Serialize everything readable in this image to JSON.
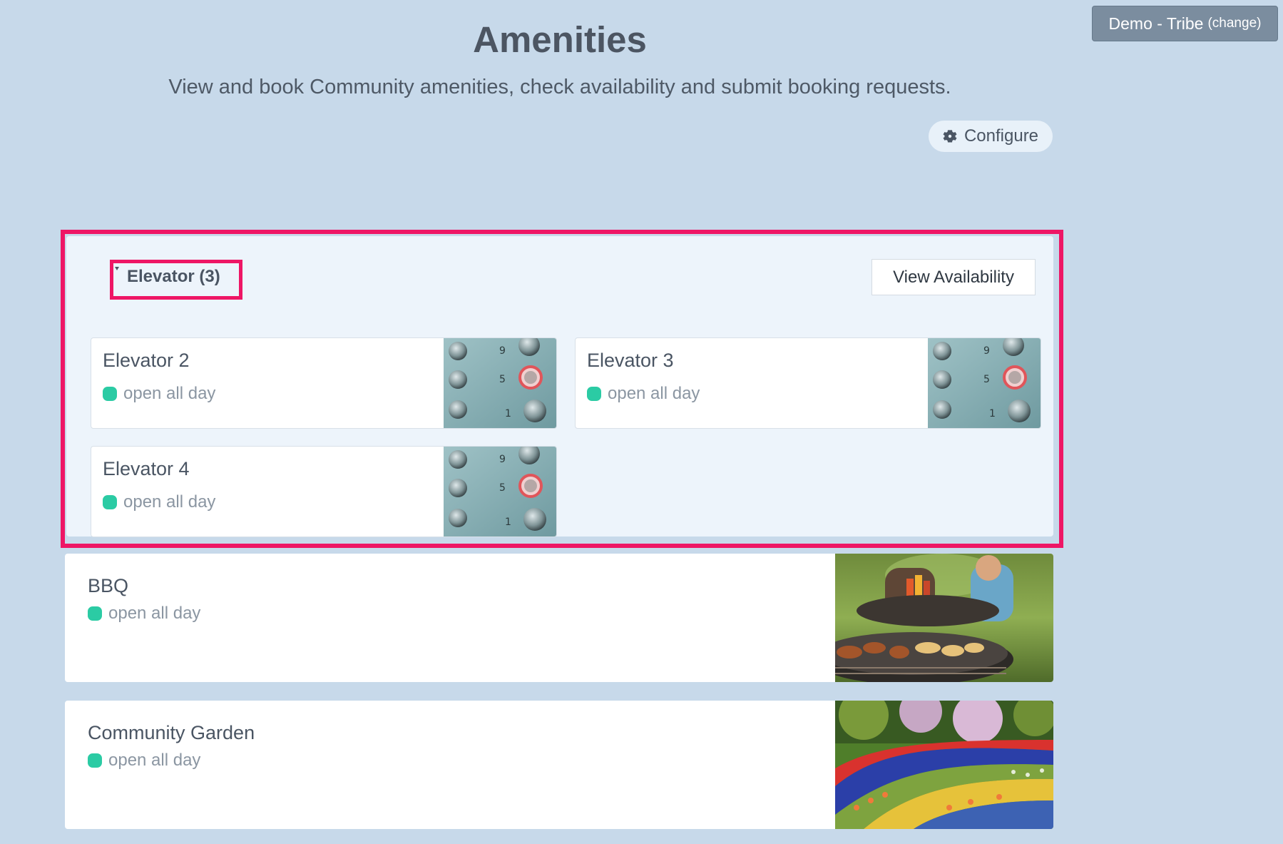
{
  "tenant": {
    "name": "Demo - Tribe",
    "change_label": "(change)"
  },
  "header": {
    "title": "Amenities",
    "subtitle": "View and book Community amenities, check availability and submit booking requests.",
    "configure_label": "Configure",
    "configure_icon": "gear-icon"
  },
  "group": {
    "title": "Elevator (3)",
    "view_availability_label": "View Availability",
    "items": [
      {
        "name": "Elevator 2",
        "status": "open all day",
        "image": "elevator-buttons-image"
      },
      {
        "name": "Elevator 3",
        "status": "open all day",
        "image": "elevator-buttons-image"
      },
      {
        "name": "Elevator 4",
        "status": "open all day",
        "image": "elevator-buttons-image"
      }
    ]
  },
  "amenities": [
    {
      "name": "BBQ",
      "status": "open all day",
      "image": "bbq-grill-image"
    },
    {
      "name": "Community Garden",
      "status": "open all day",
      "image": "tulip-garden-image"
    }
  ],
  "colors": {
    "background": "#c7d9ea",
    "highlight": "#ee1665",
    "status_open": "#2bcba4",
    "tenant_button": "#7b8d9f"
  }
}
